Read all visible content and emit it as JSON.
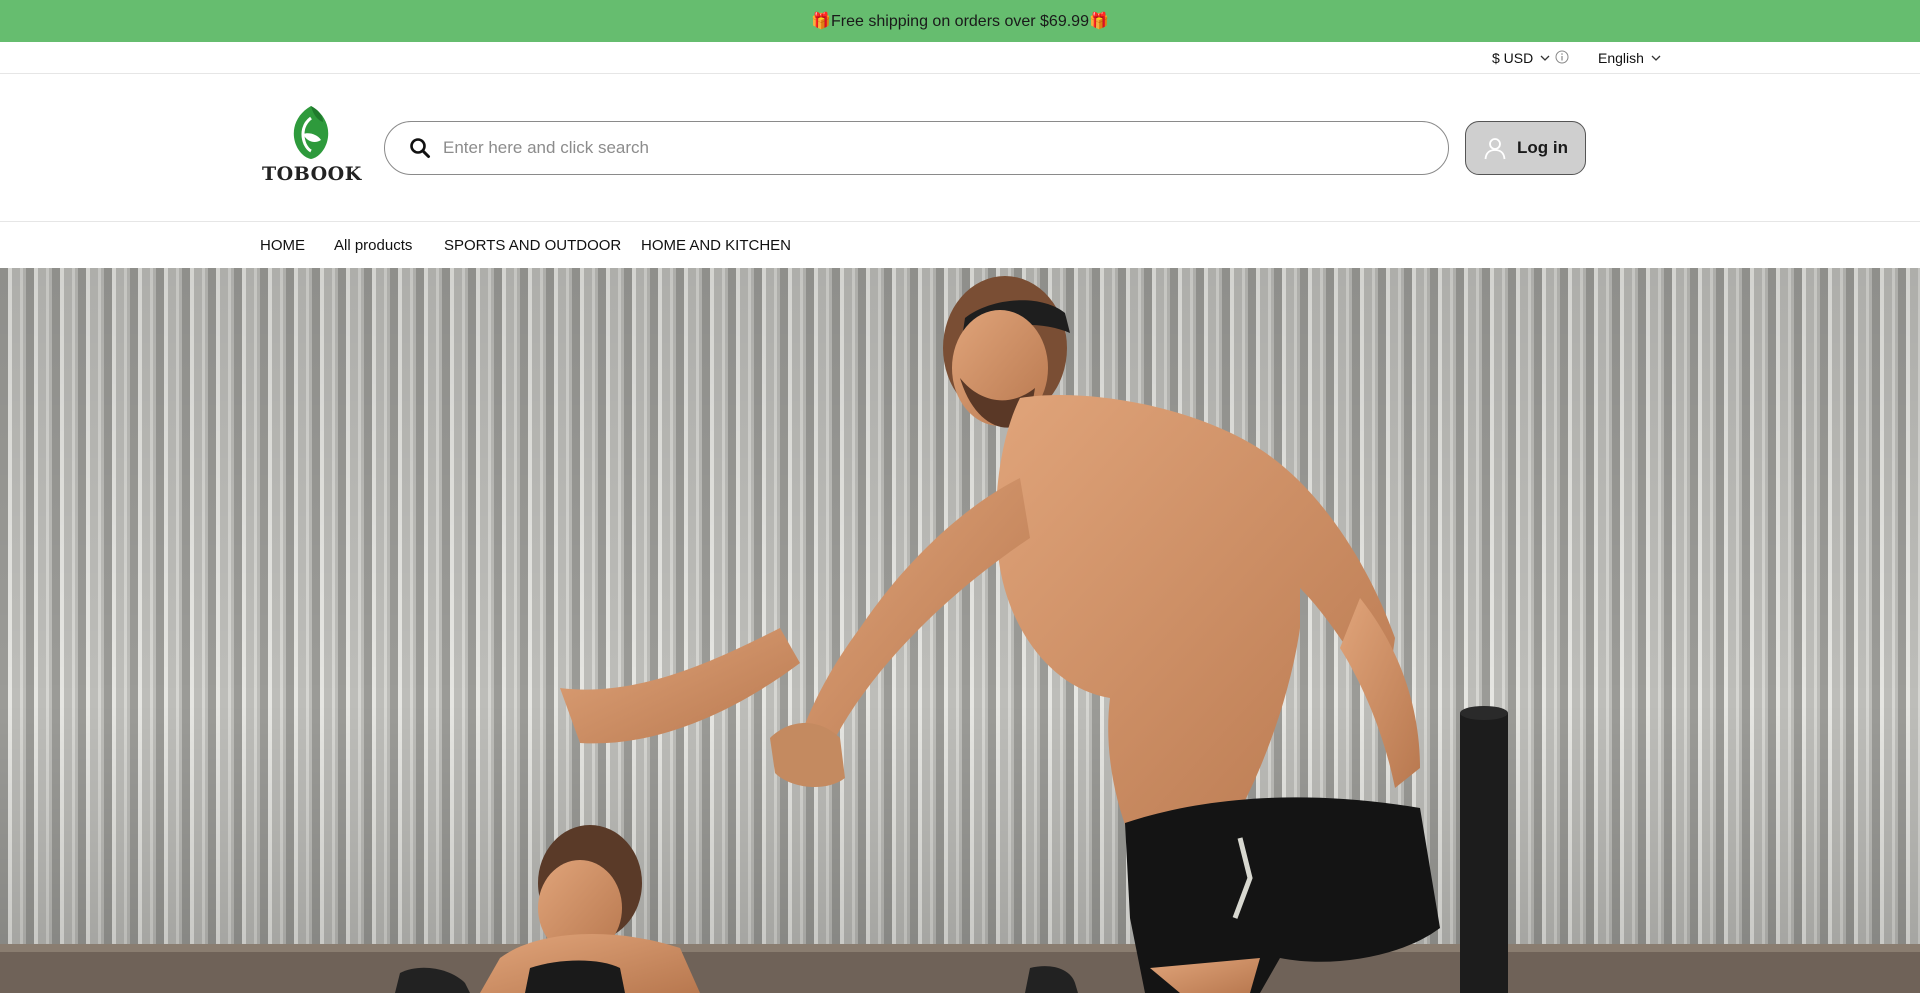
{
  "announcement": {
    "text": "🎁Free shipping on orders over $69.99🎁"
  },
  "utility": {
    "currency_label": "$ USD",
    "language_label": "English"
  },
  "header": {
    "logo_text": "TOBOOK",
    "search_placeholder": "Enter here and click search",
    "login_label": "Log in"
  },
  "nav": {
    "items": [
      {
        "label": "HOME"
      },
      {
        "label": "All products"
      },
      {
        "label": "SPORTS AND OUTDOOR"
      },
      {
        "label": "HOME AND KITCHEN"
      }
    ]
  },
  "colors": {
    "announcement_bg": "#66bd6f",
    "brand_green": "#2e9a3c",
    "login_bg": "#cfcfcf"
  },
  "hero": {
    "image": "fitness-couple-helping-hand"
  }
}
